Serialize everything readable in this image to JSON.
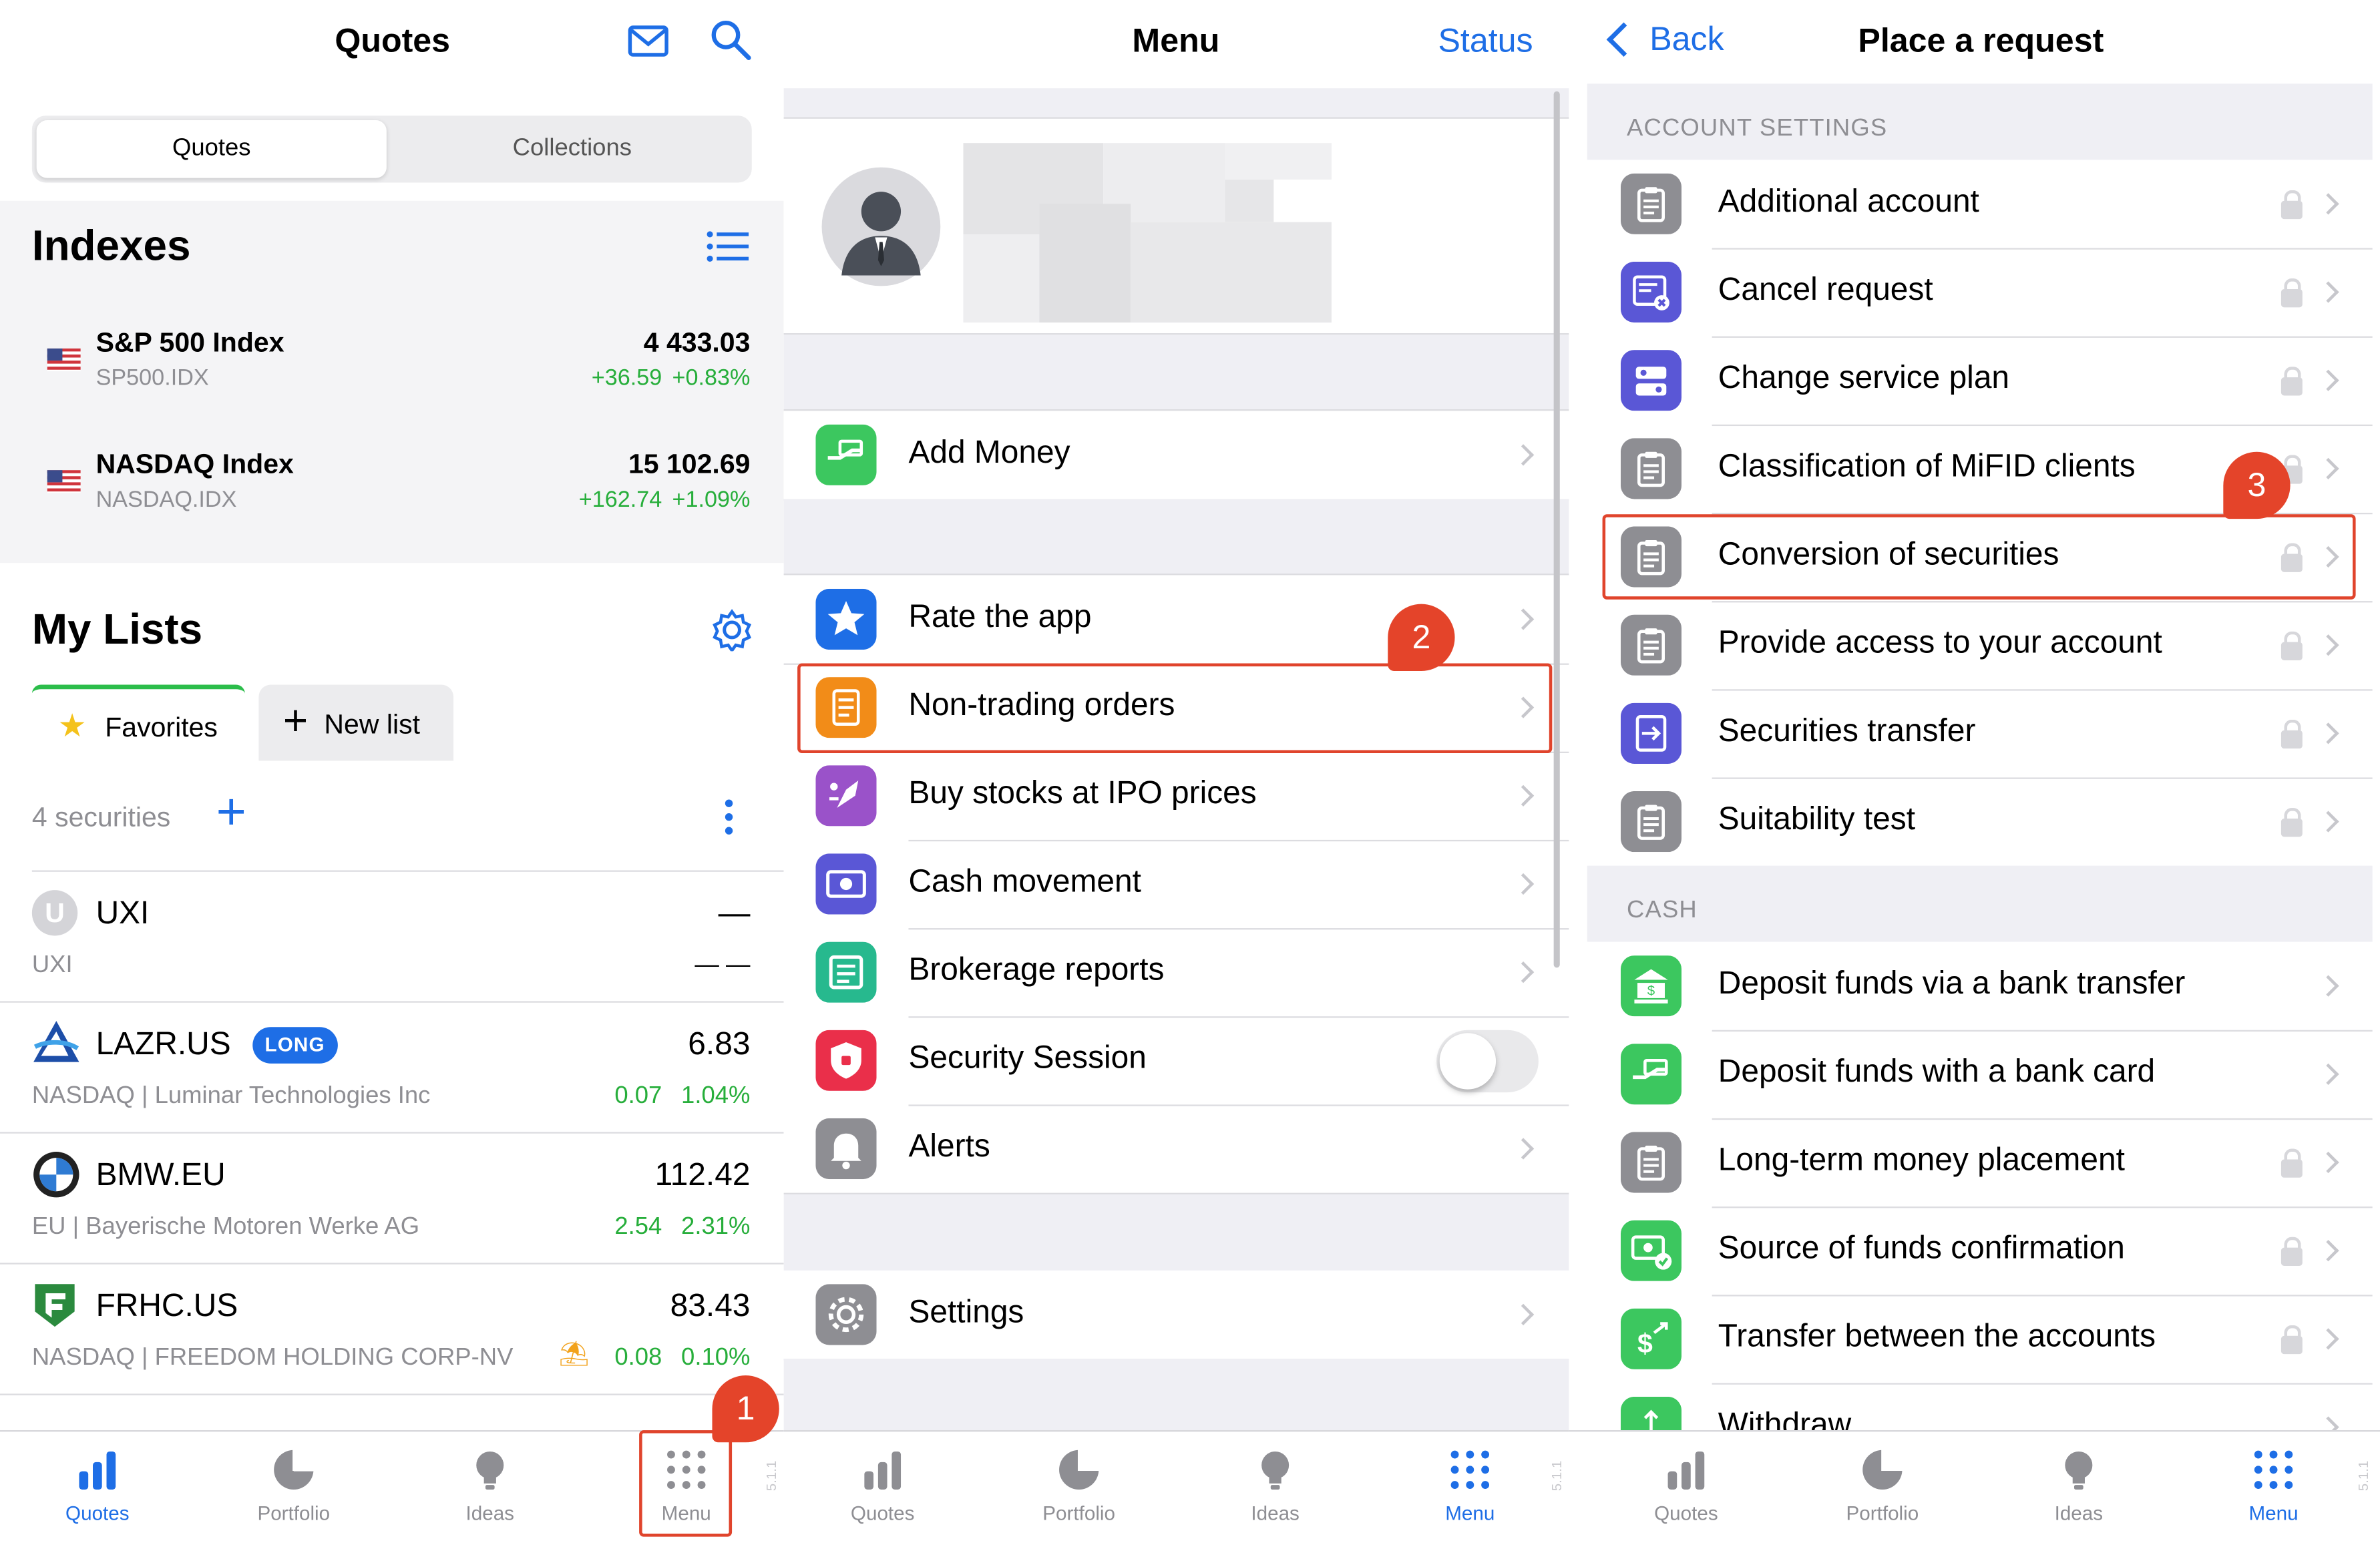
{
  "quotes_screen": {
    "title": "Quotes",
    "segments": [
      "Quotes",
      "Collections"
    ],
    "indexes_title": "Indexes",
    "indexes": [
      {
        "name": "S&P 500 Index",
        "ticker": "SP500.IDX",
        "value": "4 433.03",
        "change": "+36.59",
        "change_pct": "+0.83%"
      },
      {
        "name": "NASDAQ Index",
        "ticker": "NASDAQ.IDX",
        "value": "15 102.69",
        "change": "+162.74",
        "change_pct": "+1.09%"
      }
    ],
    "my_lists_title": "My Lists",
    "list_tabs": {
      "favorites": "Favorites",
      "new_list": "New list"
    },
    "securities_count": "4 securities",
    "securities": [
      {
        "ticker": "UXI",
        "badge": "",
        "price": "—",
        "sub": "UXI",
        "change": "",
        "change_pct": "— —",
        "logo_letter": "U"
      },
      {
        "ticker": "LAZR.US",
        "badge": "LONG",
        "price": "6.83",
        "sub": "NASDAQ | Luminar Technologies Inc",
        "change": "0.07",
        "change_pct": "1.04%"
      },
      {
        "ticker": "BMW.EU",
        "badge": "",
        "price": "112.42",
        "sub": "EU | Bayerische Motoren Werke AG",
        "change": "2.54",
        "change_pct": "2.31%"
      },
      {
        "ticker": "FRHC.US",
        "badge": "",
        "price": "83.43",
        "sub": "NASDAQ | FREEDOM HOLDING CORP-NV",
        "change": "0.08",
        "change_pct": "0.10%"
      }
    ],
    "callout": "1"
  },
  "menu_screen": {
    "title": "Menu",
    "status_link": "Status",
    "items": [
      {
        "label": "Add Money",
        "icon": "hand-money-icon",
        "color": "#3cc75f"
      },
      {
        "label": "Rate the app",
        "icon": "star-icon",
        "color": "#1e6ee6"
      },
      {
        "label": "Non-trading orders",
        "icon": "document-icon",
        "color": "#f28c18"
      },
      {
        "label": "Buy stocks at IPO prices",
        "icon": "rocket-icon",
        "color": "#9a52c9"
      },
      {
        "label": "Cash movement",
        "icon": "banknote-icon",
        "color": "#5a57d6"
      },
      {
        "label": "Brokerage reports",
        "icon": "report-icon",
        "color": "#27b98e"
      },
      {
        "label": "Security Session",
        "icon": "shield-icon",
        "color": "#ea2f4a"
      },
      {
        "label": "Alerts",
        "icon": "bell-icon",
        "color": "#8e8e93"
      },
      {
        "label": "Settings",
        "icon": "gear-icon",
        "color": "#8e8e93"
      }
    ],
    "callout": "2"
  },
  "request_screen": {
    "back": "Back",
    "title": "Place a request",
    "section_account": "ACCOUNT SETTINGS",
    "account_items": [
      {
        "label": "Additional account",
        "icon": "clipboard-icon",
        "color": "#8e8e93"
      },
      {
        "label": "Cancel request",
        "icon": "cancel-doc-icon",
        "color": "#5a57d6"
      },
      {
        "label": "Change service plan",
        "icon": "plan-icon",
        "color": "#5a57d6"
      },
      {
        "label": "Classification of MiFID clients",
        "icon": "clipboard-icon",
        "color": "#8e8e93"
      },
      {
        "label": "Conversion of securities",
        "icon": "clipboard-icon",
        "color": "#8e8e93"
      },
      {
        "label": "Provide access to your account",
        "icon": "clipboard-icon",
        "color": "#8e8e93"
      },
      {
        "label": "Securities transfer",
        "icon": "transfer-doc-icon",
        "color": "#5a57d6"
      },
      {
        "label": "Suitability test",
        "icon": "clipboard-icon",
        "color": "#8e8e93"
      }
    ],
    "section_cash": "CASH",
    "cash_items": [
      {
        "label": "Deposit funds via a bank transfer",
        "icon": "bank-icon",
        "color": "#3cc75f",
        "locked": false
      },
      {
        "label": "Deposit funds with a bank card",
        "icon": "hand-money-icon",
        "color": "#3cc75f",
        "locked": false
      },
      {
        "label": "Long-term money placement",
        "icon": "clipboard-icon",
        "color": "#8e8e93",
        "locked": true
      },
      {
        "label": "Source of funds confirmation",
        "icon": "money-check-icon",
        "color": "#3cc75f",
        "locked": true
      },
      {
        "label": "Transfer between the accounts",
        "icon": "dollar-transfer-icon",
        "color": "#3cc75f",
        "locked": true
      },
      {
        "label": "Withdraw",
        "icon": "withdraw-icon",
        "color": "#3cc75f",
        "locked": false
      }
    ],
    "callout": "3"
  },
  "tabbar": {
    "quotes": "Quotes",
    "portfolio": "Portfolio",
    "ideas": "Ideas",
    "menu": "Menu"
  },
  "version": "5.1.1",
  "colors": {
    "accent": "#1e6ee6",
    "positive": "#27ae3b",
    "callout": "#e4442a"
  }
}
